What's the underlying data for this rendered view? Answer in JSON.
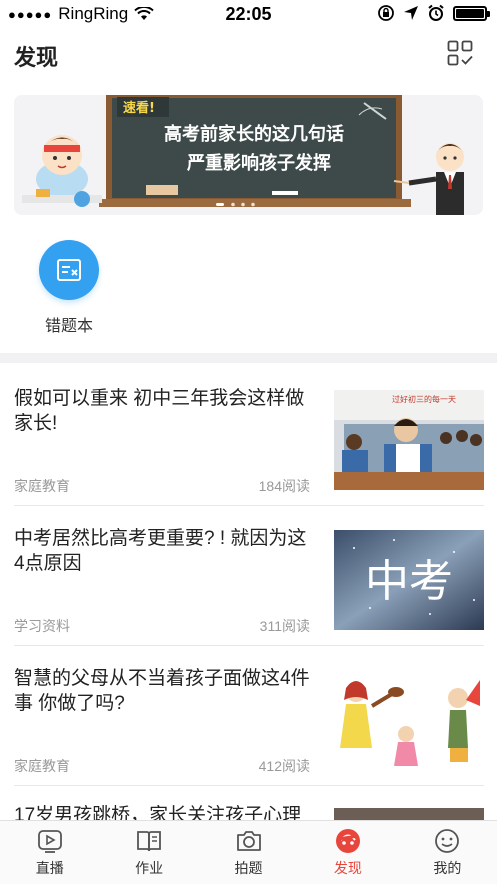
{
  "status_bar": {
    "carrier": "RingRing",
    "time": "22:05"
  },
  "header": {
    "title": "发现"
  },
  "banner": {
    "tag": "速看!",
    "line1": "高考前家长的这几句话",
    "line2": "严重影响孩子发挥",
    "active_index": 0,
    "dot_count": 4
  },
  "shortcuts": [
    {
      "label": "错题本",
      "icon": "wrong-answer-book-icon"
    }
  ],
  "articles": [
    {
      "title": "假如可以重来 初中三年我会这样做家长!",
      "category": "家庭教育",
      "reads": "184阅读",
      "thumb": "classroom-photo"
    },
    {
      "title": "中考居然比高考更重要? ! 就因为这4点原因",
      "category": "学习资料",
      "reads": "311阅读",
      "thumb": "zhongkao-starry-sky"
    },
    {
      "title": "智慧的父母从不当着孩子面做这4件事 你做了吗?",
      "category": "家庭教育",
      "reads": "412阅读",
      "thumb": "arguing-parents-cartoon"
    }
  ],
  "peek_article": {
    "title": "17岁男孩跳桥，家长关注孩子心理"
  },
  "tab_bar": {
    "items": [
      {
        "label": "直播",
        "icon": "live-play-icon"
      },
      {
        "label": "作业",
        "icon": "homework-book-icon"
      },
      {
        "label": "拍题",
        "icon": "camera-icon"
      },
      {
        "label": "发现",
        "icon": "discover-icon"
      },
      {
        "label": "我的",
        "icon": "smiley-profile-icon"
      }
    ],
    "active": "发现"
  },
  "colors": {
    "accent_blue": "#34a0f0",
    "active_tab_red": "#e8453c",
    "chalkboard": "#3e4a4a"
  }
}
